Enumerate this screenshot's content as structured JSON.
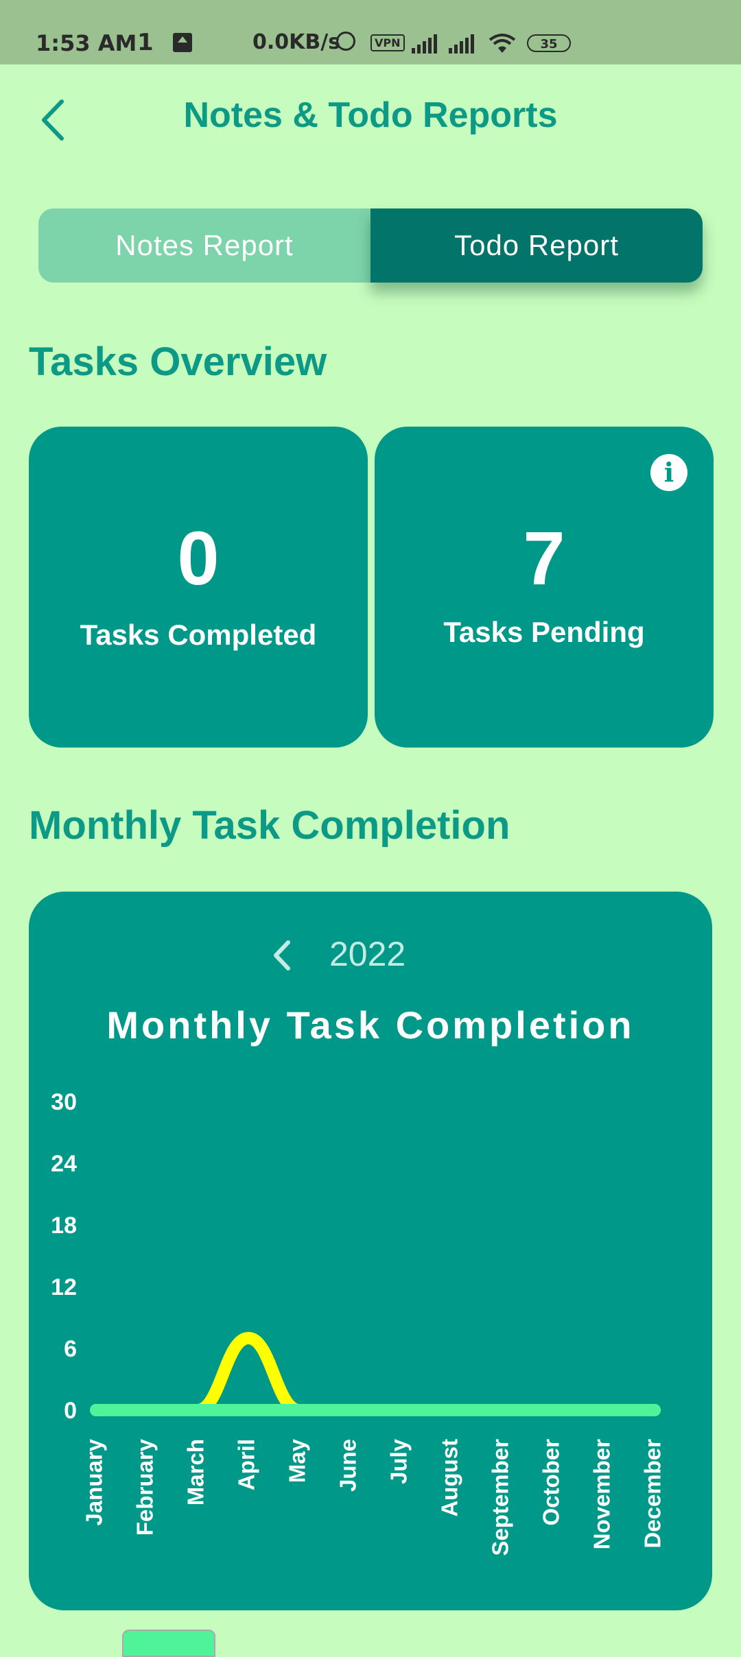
{
  "status_bar": {
    "time": "1:53 AM",
    "sim_indicator": "1",
    "network_speed": "0.0KB/s",
    "vpn": "VPN",
    "battery": "35",
    "icons": [
      "upload-icon",
      "alarm-icon",
      "vpn-icon",
      "signal-icon",
      "signal-icon",
      "wifi-icon",
      "battery-icon"
    ]
  },
  "header": {
    "title": "Notes & Todo Reports",
    "back_icon": "back-chevron-icon"
  },
  "tabs": [
    {
      "label": "Notes Report",
      "selected": false
    },
    {
      "label": "Todo Report",
      "selected": true
    }
  ],
  "overview": {
    "section_title": "Tasks Overview",
    "completed": {
      "value": "0",
      "label": "Tasks Completed"
    },
    "pending": {
      "value": "7",
      "label": "Tasks Pending",
      "icon": "info-icon"
    }
  },
  "monthly": {
    "section_title": "Monthly Task Completion",
    "year": "2022",
    "prev_icon": "chevron-left-icon"
  },
  "colors": {
    "background": "#c6fcbd",
    "accent": "#0c9a86",
    "card": "#009888",
    "selected_tab": "#03746a",
    "series_pending": "#ffff00",
    "series_completed": "#4ef39a"
  },
  "chart_data": {
    "type": "line",
    "title": "Monthly Task Completion",
    "categories": [
      "January",
      "February",
      "March",
      "April",
      "May",
      "June",
      "July",
      "August",
      "September",
      "October",
      "November",
      "December"
    ],
    "yticks": [
      "0",
      "6",
      "12",
      "18",
      "24",
      "30"
    ],
    "ylim": [
      0,
      30
    ],
    "grid": false,
    "series": [
      {
        "color": "#ffff00",
        "values": [
          0,
          0,
          0,
          7,
          0,
          0,
          0,
          0,
          0,
          0,
          0,
          0
        ]
      },
      {
        "color": "#4ef39a",
        "values": [
          0,
          0,
          0,
          0,
          0,
          0,
          0,
          0,
          0,
          0,
          0,
          0
        ]
      }
    ]
  }
}
